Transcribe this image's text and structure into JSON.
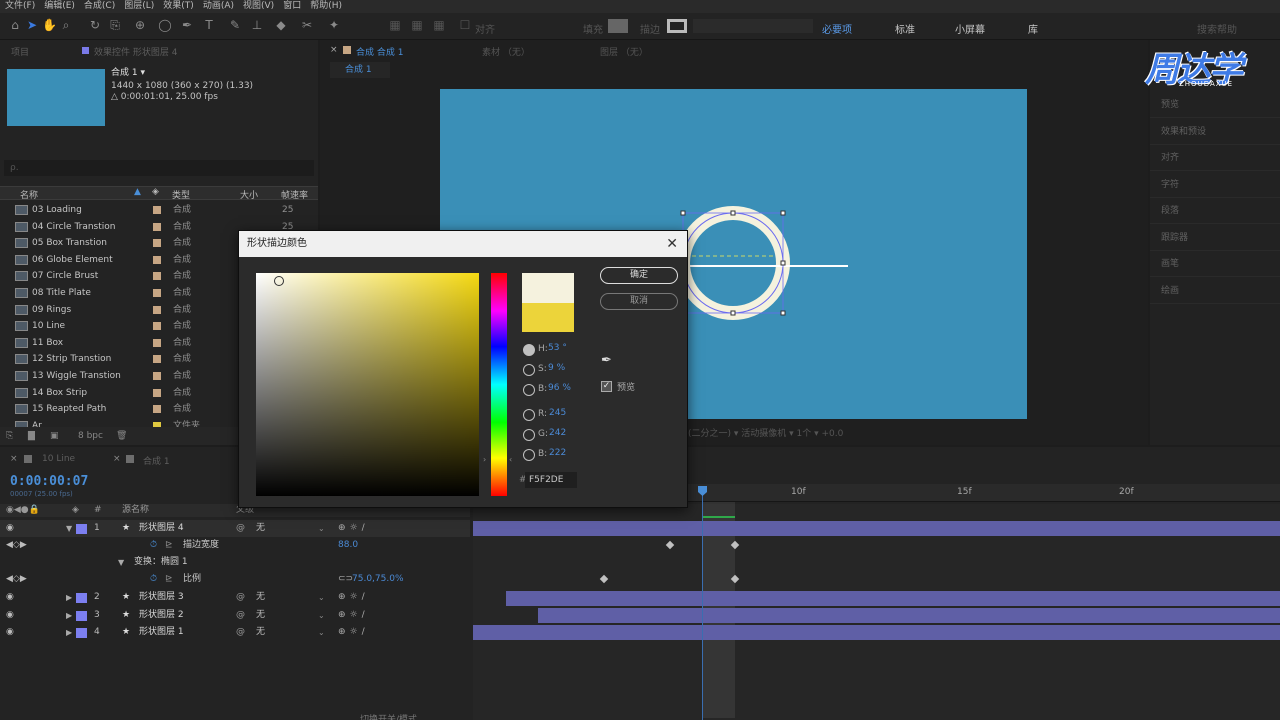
{
  "menu": [
    "文件(F)",
    "编辑(E)",
    "合成(C)",
    "图层(L)",
    "效果(T)",
    "动画(A)",
    "视图(V)",
    "窗口",
    "帮助(H)"
  ],
  "toolbar": {
    "align_label": "对齐",
    "fill_label": "填充",
    "stroke_label": "描边",
    "workspaces": [
      "必要项",
      "标准",
      "小屏幕",
      "库"
    ],
    "search_placeholder": "搜索帮助"
  },
  "project": {
    "tab_project": "项目",
    "tab_effects": "效果控件 形状图层 4",
    "comp_name": "合成 1 ▾",
    "comp_size": "1440 x 1080  (360 x 270) (1.33)",
    "comp_dur": "△ 0:00:01:01, 25.00 fps",
    "search_placeholder": "ρ.",
    "col_name": "名称",
    "col_type": "类型",
    "col_size": "大小",
    "col_rate": "帧速率",
    "items": [
      {
        "name": "03 Loading",
        "type": "合成",
        "rate": "25"
      },
      {
        "name": "04 Circle Transtion",
        "type": "合成",
        "rate": "25"
      },
      {
        "name": "05 Box Transtion",
        "type": "合成",
        "rate": ""
      },
      {
        "name": "06 Globe Element",
        "type": "合成",
        "rate": ""
      },
      {
        "name": "07 Circle Brust",
        "type": "合成",
        "rate": ""
      },
      {
        "name": "08 Title Plate",
        "type": "合成",
        "rate": ""
      },
      {
        "name": "09 Rings",
        "type": "合成",
        "rate": ""
      },
      {
        "name": "10 Line",
        "type": "合成",
        "rate": ""
      },
      {
        "name": "11 Box",
        "type": "合成",
        "rate": ""
      },
      {
        "name": "12 Strip Transtion",
        "type": "合成",
        "rate": ""
      },
      {
        "name": "13 Wiggle Transtion",
        "type": "合成",
        "rate": ""
      },
      {
        "name": "14 Box Strip",
        "type": "合成",
        "rate": ""
      },
      {
        "name": "15 Reapted Path",
        "type": "合成",
        "rate": ""
      },
      {
        "name": "Ar",
        "type": "文件夹",
        "rate": ""
      }
    ],
    "bpc": "8 bpc"
  },
  "comp": {
    "tab_main": "合成 合成 1",
    "tab_footage": "素材 （无）",
    "tab_layer": "图层 （无）",
    "sub_tab": "合成 1",
    "bottom_text": "(二分之一) ▾   活动摄像机 ▾   1个 ▾   +0.0"
  },
  "right_panel": [
    "预览",
    "效果和预设",
    "对齐",
    "字符",
    "段落",
    "跟踪器",
    "画笔",
    "绘画"
  ],
  "logo": {
    "text": "周达学",
    "sub": "ZHOUDAXUE"
  },
  "timeline": {
    "tab1": "10 Line",
    "tab2": "合成 1",
    "timecode": "0:00:00:07",
    "fps": "00007 (25.00 fps)",
    "head_name": "源名称",
    "head_parent": "父级",
    "ticks": [
      "10f",
      "15f",
      "20f"
    ],
    "layers": [
      {
        "num": "1",
        "name": "形状图层 4",
        "parent": "无"
      },
      {
        "num": "2",
        "name": "形状图层 3",
        "parent": "无"
      },
      {
        "num": "3",
        "name": "形状图层 2",
        "parent": "无"
      },
      {
        "num": "4",
        "name": "形状图层 1",
        "parent": "无"
      }
    ],
    "prop_stroke_label": "描边宽度",
    "prop_stroke_value": "88.0",
    "prop_transform_label": "变换：椭圆 1",
    "prop_scale_label": "比例",
    "prop_scale_value": "75.0,75.0%",
    "footer": "切换开关/模式"
  },
  "dialog": {
    "title": "形状描边颜色",
    "ok": "确定",
    "cancel": "取消",
    "preview": "预览",
    "h_label": "H:",
    "h_value": "53 °",
    "s_label": "S:",
    "s_value": "9 %",
    "b_label": "B:",
    "b_value": "96 %",
    "r_label": "R:",
    "r_value": "245",
    "g_label": "G:",
    "g_value": "242",
    "bl_label": "B:",
    "bl_value": "222",
    "hex_label": "#",
    "hex_value": "F5F2DE",
    "new_color": "#F5F2DE",
    "old_color": "#ECD43A"
  }
}
